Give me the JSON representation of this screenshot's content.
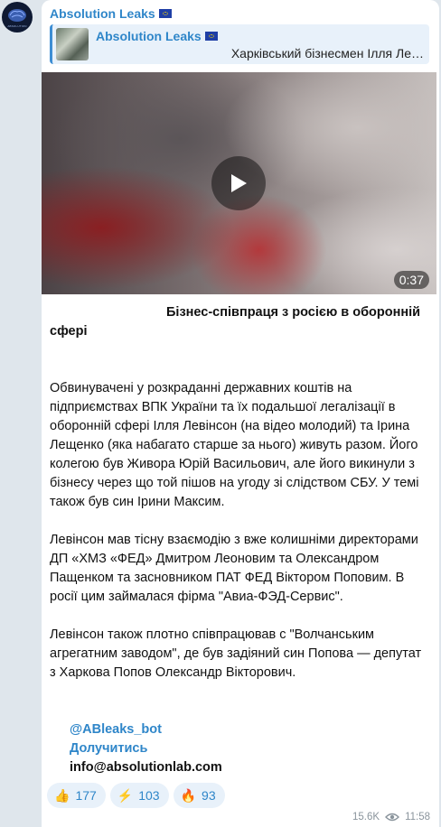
{
  "channel": {
    "name": "Absolution Leaks",
    "avatar_text": "ABSOLUTION"
  },
  "reply": {
    "name": "Absolution Leaks",
    "preview": "Харківський бізнесмен Ілля Ле…"
  },
  "video": {
    "duration": "0:37"
  },
  "post": {
    "heading": "Бізнес-співпраця з росією в оборонній сфері",
    "paragraphs": [
      "Обвинувачені у розкраданні державних коштів на підприємствах ВПК України та їх подальшої легалізації в оборонній сфері Ілля Левінсон (на відео молодий) та Ірина Лещенко (яка набагато старше за нього) живуть разом. Його колегою був Живора Юрій Васильович, але його викинули з бізнесу через що той пішов на угоду зі слідством СБУ. У темі також був син Ірини Максим.",
      "Левінсон мав тісну взаємодію з вже колишніми директорами ДП «ХМЗ «ФЕД» Дмитром Леоновим та Олександром Пащенком та засновником ПАТ ФЕД Віктором Поповим. В росії цим займалася фірма \"Авиа-ФЭД-Сервис\".",
      "Левінсон також плотно співпрацював с \"Волчанським агрегатним заводом\", де був задіяний син Попова — депутат з Харкова Попов Олександр Вікторович."
    ],
    "bot_link": "@ABleaks_bot",
    "join_link": "Долучитись",
    "email": "info@absolutionlab.com"
  },
  "reactions": [
    {
      "emoji": "👍",
      "count": "177"
    },
    {
      "emoji": "⚡",
      "count": "103"
    },
    {
      "emoji": "🔥",
      "count": "93"
    }
  ],
  "meta": {
    "views": "15.6K",
    "time": "11:58"
  },
  "colors": {
    "accent": "#2f86c9",
    "background": "#dfe6ec"
  }
}
